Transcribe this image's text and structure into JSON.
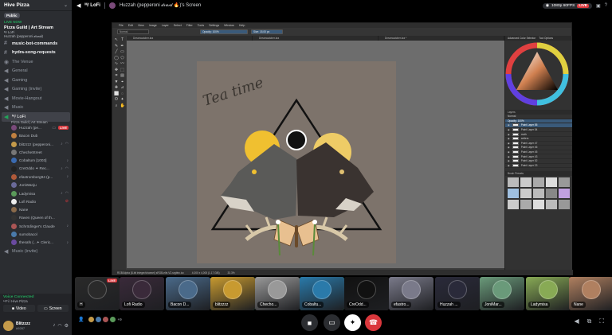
{
  "server": {
    "name": "Hive Pizza",
    "badge_public": "Public",
    "live_now": "LIVE NOW",
    "event_title": "Pizza Guild | Art Stream",
    "event_channel": "ᴹᵢᵗ LoFi",
    "event_sub": "Huzzah (pepperoni 𝒹𝓇𝓊𝒾𝒹)"
  },
  "channels": {
    "c1": "music-bot-commands",
    "c2": "hydra-song-requests",
    "c3": "The Venue",
    "c4": "General",
    "c5": "Gaming",
    "c6": "Gaming (invite)",
    "c7": "Movie-Hangout",
    "c8": "Music",
    "active_name": "ᴹᵢᵗ LoFi",
    "active_sub": "Pizza Guild | Art Stream",
    "bottom_channel": "Music (invite)"
  },
  "voice_users": [
    {
      "name": "Huzzah (pe...",
      "color": "#7a4a7a",
      "live": "LIVE"
    },
    {
      "name": "Bacon Dub",
      "color": "#c08040"
    },
    {
      "name": "blitzzzz (pepperoni...",
      "color": "#c49a4a"
    },
    {
      "name": "ChecheStreet",
      "color": "#777777"
    },
    {
      "name": "Cobaltum [1003]",
      "color": "#3a6ab0"
    },
    {
      "name": "CreOddo ✦ Rec...",
      "color": "#222222"
    },
    {
      "name": "efastromberg94 (p...",
      "color": "#b05a3a"
    },
    {
      "name": "JoniWanju",
      "color": "#6a6a9a"
    },
    {
      "name": "Ladymisa",
      "color": "#5a9a5a"
    },
    {
      "name": "Lofi Radio",
      "color": "#eeeeee"
    },
    {
      "name": "Nane",
      "color": "#8a6a4a"
    },
    {
      "name": "Raven (Queen of th...",
      "color": "#333333"
    },
    {
      "name": "Schrödinger's Claude",
      "color": "#aa5555"
    },
    {
      "name": "sumobacol",
      "color": "#4a7aaa"
    },
    {
      "name": "thesafs (...✦ Cleric...",
      "color": "#6a4aa0"
    }
  ],
  "voice_panel": {
    "status": "Voice Connected",
    "sub": "ᴸᵒFi / Hive Pizza",
    "video": "Video",
    "screen": "Screen"
  },
  "user": {
    "name": "Blitzzzz",
    "disc": "#9287"
  },
  "topbar": {
    "channel": "ᴹᵢᵗ LoFi",
    "streamer": "Huzzah (pepperoni 𝒹𝓇𝓊𝒾𝒹 🔥)'s Screen",
    "quality": "1080p 60FPS",
    "live": "LIVE"
  },
  "krita": {
    "menu": [
      "File",
      "Edit",
      "View",
      "Image",
      "Layer",
      "Select",
      "Filter",
      "Tools",
      "Settings",
      "Window",
      "Help"
    ],
    "opacity": "Opacity: 100%",
    "size": "Size: 15.00 px",
    "blend": "Normal",
    "tabs": [
      "Dreamcatcher.kra",
      "Dreamcatcher.kra",
      "Dreamcatcher.kra *"
    ],
    "status": [
      "RGB/Alpha (8-bit integer/channel)  sRGB-elle-V2-srgbtrc.icc",
      "4,000 x 4,000 (1.17 GiB)",
      "33.3%"
    ],
    "dock_tabs": [
      "Advanced Color Selector",
      "Tool Options"
    ],
    "layers_title": "Layers",
    "layers_blend": "Normal",
    "layers_opacity": "Opacity: 100%",
    "layers": [
      "Paint Layer 55",
      "Paint Layer 54",
      "moth",
      "antlers",
      "Paint Layer 47",
      "Paint Layer 46",
      "Paint Layer 45",
      "Paint Layer 43",
      "Paint Layer 52",
      "Paint Layer 23"
    ],
    "presets_title": "Brush Presets",
    "handwriting": "Tea time"
  },
  "tiles": [
    {
      "name": "H",
      "color": "#2a2a2a",
      "live": "LIVE"
    },
    {
      "name": "Lofi Radio",
      "color": "#3a2a3a"
    },
    {
      "name": "Bacon D...",
      "color": "#4a6a8a"
    },
    {
      "name": "blitzzzz",
      "color": "#c89a30"
    },
    {
      "name": "Checho...",
      "color": "#999999"
    },
    {
      "name": "Cobaltu...",
      "color": "#2a7aaa"
    },
    {
      "name": "CreOdd...",
      "color": "#111111"
    },
    {
      "name": "efastro...",
      "color": "#7a7a8a"
    },
    {
      "name": "Huzzah ...",
      "color": "#2a2a3a"
    },
    {
      "name": "JoniMar...",
      "color": "#6a9a7a"
    },
    {
      "name": "Ladymisa",
      "color": "#88aa55"
    },
    {
      "name": "Nane",
      "color": "#b08060"
    }
  ],
  "bottom": {
    "listener_count": "+9"
  },
  "colors": {
    "accent_green": "#23a55a",
    "live_red": "#da373c",
    "sidebar_bg": "#2b2d31"
  }
}
